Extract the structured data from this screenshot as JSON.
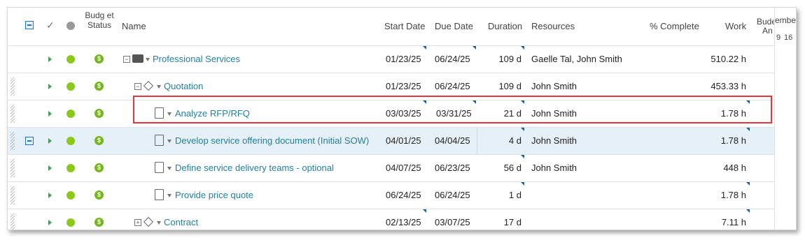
{
  "header": {
    "budget_status": "Budg et Status",
    "name": "Name",
    "start_date": "Start Date",
    "due_date": "Due Date",
    "duration": "Duration",
    "resources": "Resources",
    "percent_complete": "% Complete",
    "work": "Work",
    "budget_cut": "Bude",
    "budget_cut2": "An",
    "month_cut": "embe",
    "day1": "9",
    "day2": "16"
  },
  "rows": [
    {
      "name": "Professional Services",
      "start": "01/23/25",
      "due": "06/24/25",
      "duration": "109 d",
      "resources": "Gaelle Tal, John Smith",
      "work": "510.22 h"
    },
    {
      "name": "Quotation",
      "start": "01/23/25",
      "due": "06/24/25",
      "duration": "109 d",
      "resources": "John Smith",
      "work": "453.33 h"
    },
    {
      "name": "Analyze RFP/RFQ",
      "start": "03/03/25",
      "due": "03/31/25",
      "duration": "21 d",
      "resources": "John Smith",
      "work": "1.78 h"
    },
    {
      "name": "Develop service offering document (Initial SOW)",
      "start": "04/01/25",
      "due": "04/04/25",
      "duration": "4 d",
      "resources": "John Smith",
      "work": "1.78 h"
    },
    {
      "name": "Define service delivery teams - optional",
      "start": "04/07/25",
      "due": "06/23/25",
      "duration": "56 d",
      "resources": "John Smith",
      "work": "448 h"
    },
    {
      "name": "Provide price quote",
      "start": "06/24/25",
      "due": "06/24/25",
      "duration": "1 d",
      "resources": "",
      "work": "1.78 h"
    },
    {
      "name": "Contract",
      "start": "02/13/25",
      "due": "03/07/25",
      "duration": "17 d",
      "resources": "",
      "work": "7.11 h"
    }
  ],
  "icons": {
    "check": "checkmark-icon",
    "status": "status-dot-icon",
    "budget": "dollar-icon",
    "project": "briefcase-icon",
    "milestone": "diamond-icon",
    "task": "clipboard-icon"
  },
  "colors": {
    "link": "#23809e",
    "highlight_border": "#e2373e",
    "selected_row": "#e6f0f8",
    "status_green": "#8bc81a"
  }
}
